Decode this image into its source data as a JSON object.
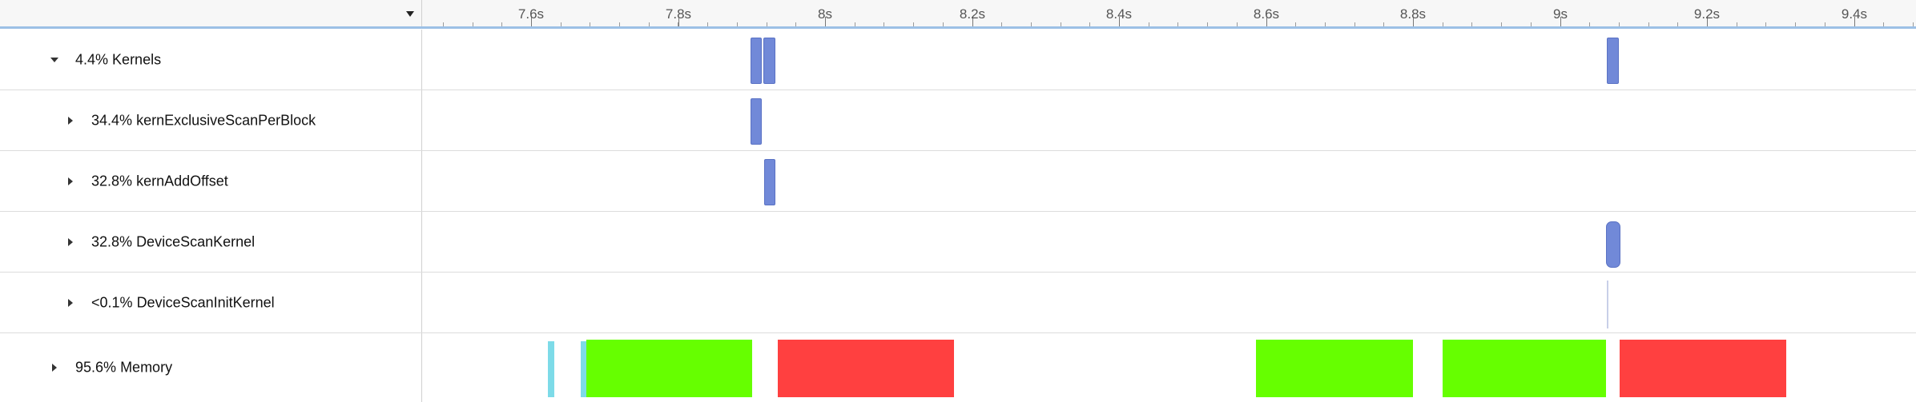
{
  "header": {
    "dropdown_icon": "chevron-down-icon",
    "ticks": [
      "7.6s",
      "7.8s",
      "8s",
      "8.2s",
      "8.4s",
      "8.6s",
      "8.8s",
      "9s",
      "9.2s",
      "9.4s"
    ]
  },
  "rows": {
    "kernels": {
      "percent": "4.4%",
      "name": "Kernels",
      "expanded": true
    },
    "scan_per_block": {
      "percent": "34.4%",
      "name": "kernExclusiveScanPerBlock"
    },
    "add_offset": {
      "percent": "32.8%",
      "name": "kernAddOffset"
    },
    "device_scan": {
      "percent": "32.8%",
      "name": "DeviceScanKernel"
    },
    "device_scan_init": {
      "percent": "<0.1%",
      "name": "DeviceScanInitKernel"
    },
    "memory": {
      "percent": "95.6%",
      "name": "Memory",
      "expanded": false
    }
  },
  "colors": {
    "kernel": "#7189d8",
    "memory_htod": "#66ff00",
    "memory_dtoh": "#ff4040",
    "memory_other": "#7ddbe8",
    "header_accent": "#9cc0e6"
  }
}
